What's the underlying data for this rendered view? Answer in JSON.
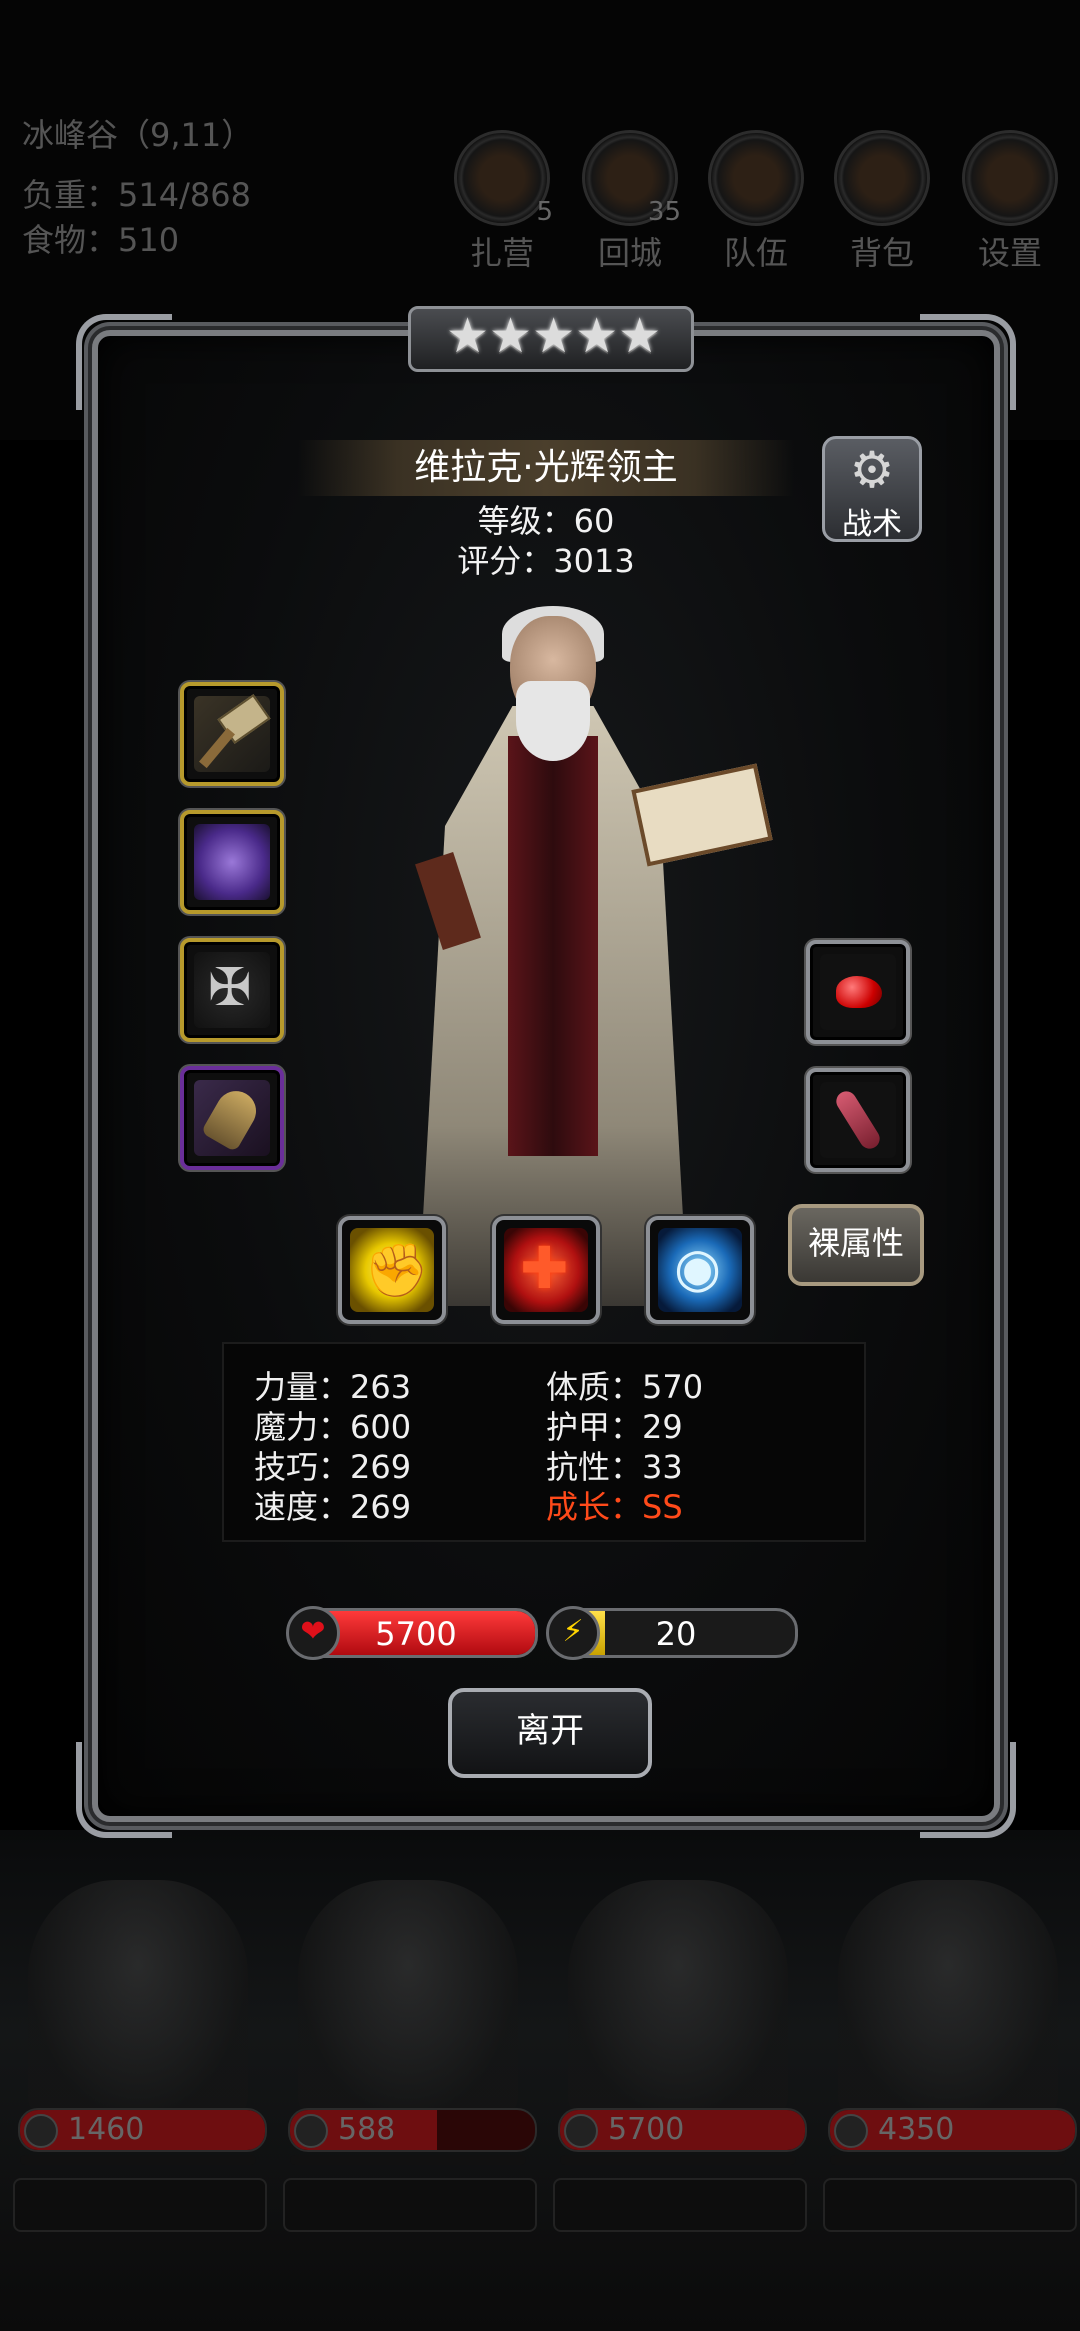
{
  "hud": {
    "location": "冰峰谷（9,11）",
    "load": "负重：514/868",
    "food": "食物：510",
    "buttons": [
      {
        "label": "扎营",
        "badge": "5",
        "icon": "campfire-icon"
      },
      {
        "label": "回城",
        "badge": "35",
        "icon": "portal-icon"
      },
      {
        "label": "队伍",
        "badge": "",
        "icon": "team-icon"
      },
      {
        "label": "背包",
        "badge": "",
        "icon": "backpack-icon"
      },
      {
        "label": "设置",
        "badge": "",
        "icon": "gear-icon"
      }
    ]
  },
  "hero": {
    "stars": "★★★★★",
    "name": "维拉克·光辉领主",
    "level": "等级：60",
    "score": "评分：3013",
    "tactics_label": "战术",
    "raw_attr_label": "裸属性",
    "equipment_left": [
      {
        "icon": "warhammer-icon",
        "rarity": "gold"
      },
      {
        "icon": "chest-armor-icon",
        "rarity": "gold"
      },
      {
        "icon": "cross-amulet-icon",
        "rarity": "gold"
      },
      {
        "icon": "gauntlet-icon",
        "rarity": "purple"
      }
    ],
    "equipment_right": [
      {
        "icon": "red-gem-icon",
        "rarity": "gray"
      },
      {
        "icon": "meat-icon",
        "rarity": "gray"
      }
    ],
    "skills": [
      {
        "icon": "fist-skill-icon"
      },
      {
        "icon": "heal-cross-skill-icon"
      },
      {
        "icon": "eye-skill-icon"
      }
    ],
    "stats": {
      "strength": "力量：263",
      "magic": "魔力：600",
      "skill": "技巧：269",
      "speed": "速度：269",
      "constitution": "体质：570",
      "armor": "护甲：29",
      "resistance": "抗性：33",
      "growth": "成长：SS"
    },
    "hp": "5700",
    "hp_fraction": 1.0,
    "energy": "20",
    "energy_fraction": 0.2,
    "leave_label": "离开"
  },
  "team": [
    {
      "hp": "1460",
      "hp_fraction": 1.0
    },
    {
      "hp": "588",
      "hp_fraction": 0.6
    },
    {
      "hp": "5700",
      "hp_fraction": 1.0
    },
    {
      "hp": "4350",
      "hp_fraction": 1.0
    }
  ],
  "colors": {
    "hp_red": "#d01018",
    "energy_yellow": "#e8c400",
    "growth_orange": "#ff4a1a",
    "slot_gold": "#b79a2c",
    "slot_purple": "#6a2e9a"
  }
}
